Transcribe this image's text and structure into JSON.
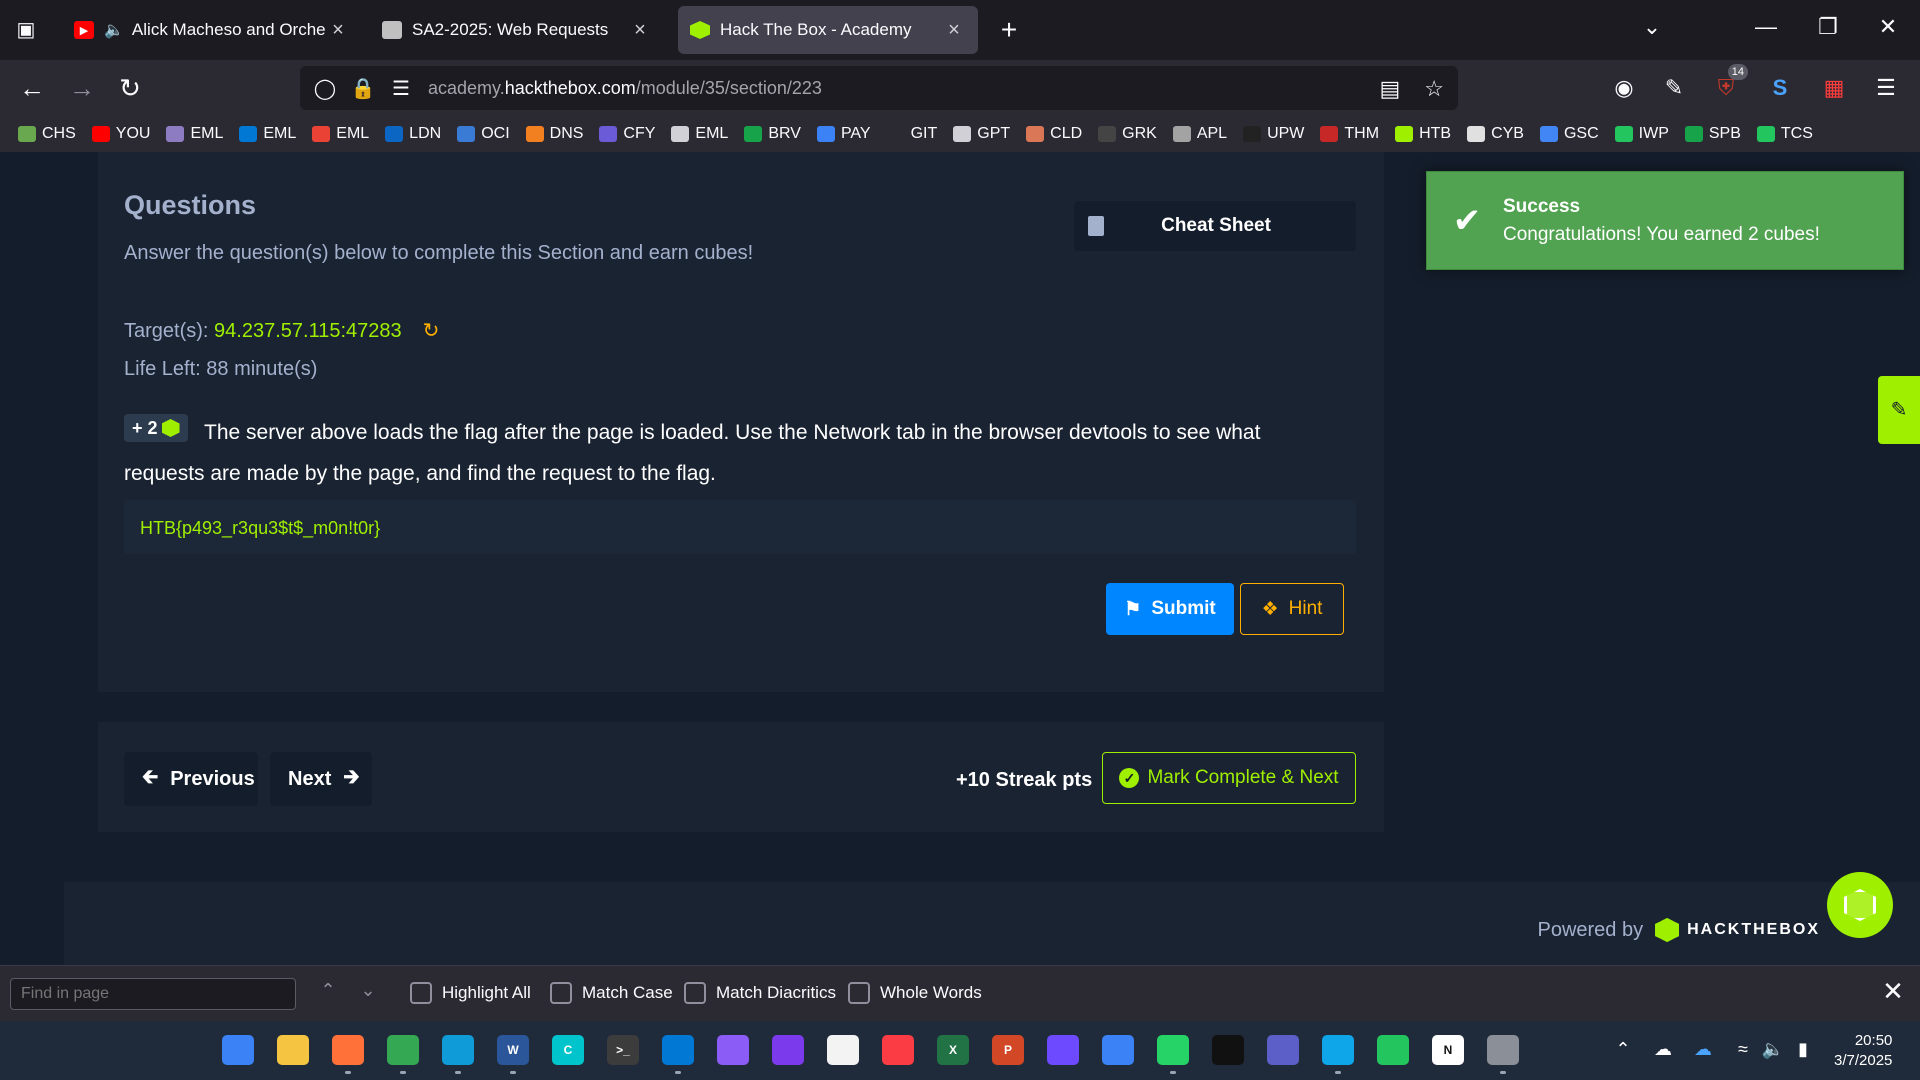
{
  "browser": {
    "tabs": [
      {
        "title": "Alick Macheso and Orchestra",
        "favicon": "youtube-icon",
        "color": "#ff0000",
        "audio": true
      },
      {
        "title": "SA2-2025: Web Requests",
        "favicon": "document-icon",
        "color": "#c0c0c0"
      },
      {
        "title": "Hack The Box - Academy",
        "favicon": "htb-cube-icon",
        "color": "#9fef00",
        "active": true
      }
    ],
    "url_prefix": "academy.",
    "url_host": "hackthebox.com",
    "url_path": "/module/35/section/223",
    "extension_badge": "14",
    "bookmarks": [
      {
        "label": "CHS",
        "color": "#6aa84f"
      },
      {
        "label": "YOU",
        "color": "#ff0000"
      },
      {
        "label": "EML",
        "color": "#8e7cc3"
      },
      {
        "label": "EML",
        "color": "#0078d4"
      },
      {
        "label": "EML",
        "color": "#ea4335"
      },
      {
        "label": "LDN",
        "color": "#0a66c2"
      },
      {
        "label": "OCI",
        "color": "#3a7bd5"
      },
      {
        "label": "DNS",
        "color": "#f38020"
      },
      {
        "label": "CFY",
        "color": "#6b5bd6"
      },
      {
        "label": "EML",
        "color": "#d0d0d6"
      },
      {
        "label": "BRV",
        "color": "#16a34a"
      },
      {
        "label": "PAY",
        "color": "#3b82f6"
      },
      {
        "label": "GIT",
        "color": "#2b2a33"
      },
      {
        "label": "GPT",
        "color": "#d0d0d6"
      },
      {
        "label": "CLD",
        "color": "#d97757"
      },
      {
        "label": "GRK",
        "color": "#444444"
      },
      {
        "label": "APL",
        "color": "#a3a3a3"
      },
      {
        "label": "UPW",
        "color": "#222222"
      },
      {
        "label": "THM",
        "color": "#c62828"
      },
      {
        "label": "HTB",
        "color": "#9fef00"
      },
      {
        "label": "CYB",
        "color": "#e0e0e0"
      },
      {
        "label": "GSC",
        "color": "#4285f4"
      },
      {
        "label": "IWP",
        "color": "#22c55e"
      },
      {
        "label": "SPB",
        "color": "#16a34a"
      },
      {
        "label": "TCS",
        "color": "#22c55e"
      }
    ]
  },
  "section": {
    "title": "Questions",
    "subtitle": "Answer the question(s) below to complete this Section and earn cubes!",
    "cheat_sheet_label": "Cheat Sheet",
    "target_label": "Target(s):",
    "target_ip": "94.237.57.115:47283",
    "life_left": "Life Left: 88 minute(s)",
    "cube_reward": "+ 2",
    "question": "The server above loads the flag after the page is loaded. Use the Network tab in the browser devtools to see what requests are made by the page, and find the request to the flag.",
    "answer": "HTB{p493_r3qu3$t$_m0n!t0r}",
    "submit_label": "Submit",
    "hint_label": "Hint"
  },
  "navigation": {
    "previous_label": "Previous",
    "next_label": "Next",
    "streak": "+10 Streak pts",
    "mark_complete_label": "Mark Complete & Next"
  },
  "footer": {
    "powered_by": "Powered by",
    "brand": "HACKTHEBOX"
  },
  "toast": {
    "title": "Success",
    "message": "Congratulations! You earned 2 cubes!"
  },
  "findbar": {
    "placeholder": "Find in page",
    "options": [
      "Highlight All",
      "Match Case",
      "Match Diacritics",
      "Whole Words"
    ]
  },
  "taskbar": {
    "apps": [
      {
        "name": "start-icon",
        "color": "#3b82f6",
        "label": ""
      },
      {
        "name": "file-explorer-icon",
        "color": "#f5c542",
        "label": ""
      },
      {
        "name": "firefox-icon",
        "color": "#ff7139",
        "label": ""
      },
      {
        "name": "chrome-icon",
        "color": "#34a853",
        "label": ""
      },
      {
        "name": "edge-icon",
        "color": "#0f9bd7",
        "label": ""
      },
      {
        "name": "word-icon",
        "color": "#2b579a",
        "label": "W"
      },
      {
        "name": "canva-icon",
        "color": "#00c4cc",
        "label": "C"
      },
      {
        "name": "terminal-icon",
        "color": "#3c3c3c",
        "label": ">_"
      },
      {
        "name": "vscode-icon",
        "color": "#0078d4",
        "label": ""
      },
      {
        "name": "notepad-icon",
        "color": "#8b5cf6",
        "label": ""
      },
      {
        "name": "obsidian-icon",
        "color": "#7c3aed",
        "label": ""
      },
      {
        "name": "store-icon",
        "color": "#f3f3f3",
        "label": ""
      },
      {
        "name": "itunes-icon",
        "color": "#fc3c44",
        "label": ""
      },
      {
        "name": "excel-icon",
        "color": "#217346",
        "label": "X"
      },
      {
        "name": "powerpoint-icon",
        "color": "#d24726",
        "label": "P"
      },
      {
        "name": "proton-vpn-icon",
        "color": "#6d4aff",
        "label": ""
      },
      {
        "name": "notepad-plus-icon",
        "color": "#3b82f6",
        "label": ""
      },
      {
        "name": "whatsapp-icon",
        "color": "#25d366",
        "label": ""
      },
      {
        "name": "capcut-icon",
        "color": "#111111",
        "label": ""
      },
      {
        "name": "teams-icon",
        "color": "#5b5fc7",
        "label": ""
      },
      {
        "name": "snipping-icon",
        "color": "#0ea5e9",
        "label": ""
      },
      {
        "name": "virtualbox-icon",
        "color": "#22c55e",
        "label": ""
      },
      {
        "name": "notion-icon",
        "color": "#ffffff",
        "label": "N"
      },
      {
        "name": "settings-icon",
        "color": "#8a8f98",
        "label": ""
      }
    ],
    "time": "20:50",
    "date": "3/7/2025"
  }
}
